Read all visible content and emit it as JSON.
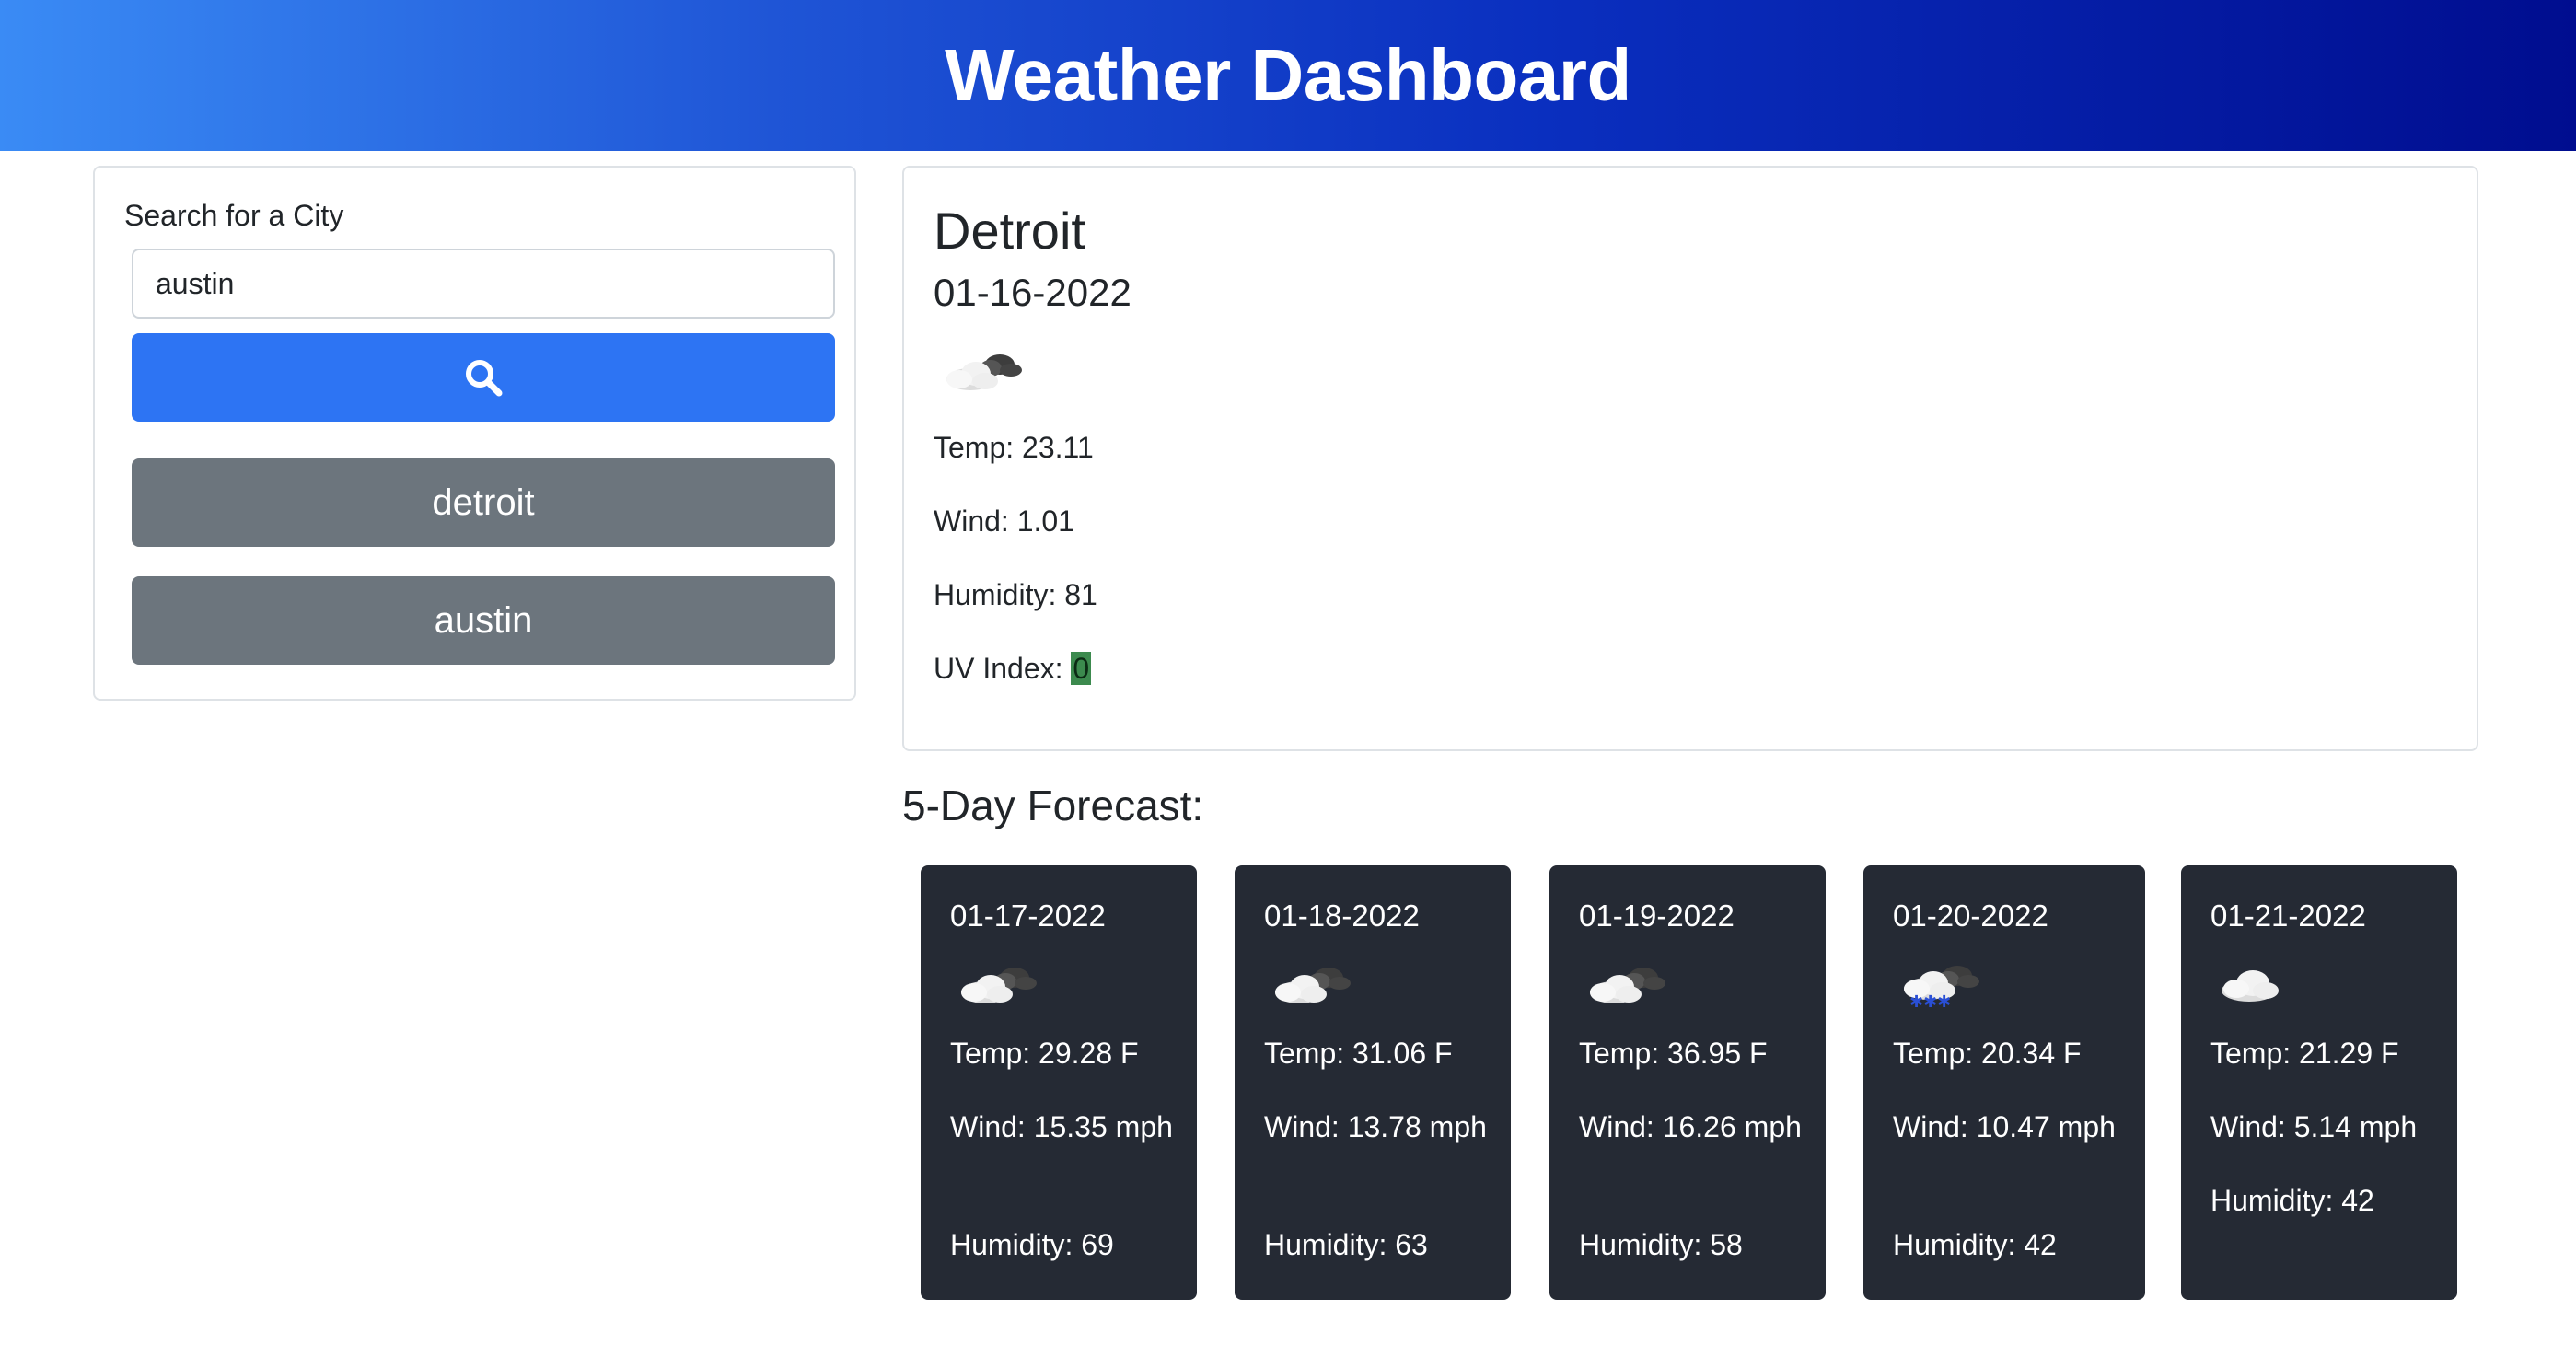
{
  "header": {
    "title": "Weather Dashboard"
  },
  "search": {
    "label": "Search for a City",
    "value": "austin",
    "button_icon": "search-icon",
    "history": [
      "detroit",
      "austin"
    ],
    "colors": {
      "search_button": "#2d74f3",
      "history_button": "#6c757d"
    }
  },
  "current": {
    "city": "Detroit",
    "date": "01-16-2022",
    "icon": "partly-cloudy-icon",
    "temp": "Temp: 23.11",
    "wind": "Wind: 1.01",
    "humidity": "Humidity: 81",
    "uv_label": "UV Index: ",
    "uv_value": "0",
    "uv_color": "#3c8a4e"
  },
  "forecast": {
    "title": "5-Day Forecast:",
    "days": [
      {
        "date": "01-17-2022",
        "icon": "partly-cloudy-icon",
        "temp": "Temp: 29.28 F",
        "wind": "Wind: 15.35 mph",
        "humidity": "Humidity: 69"
      },
      {
        "date": "01-18-2022",
        "icon": "partly-cloudy-icon",
        "temp": "Temp: 31.06 F",
        "wind": "Wind: 13.78 mph",
        "humidity": "Humidity: 63"
      },
      {
        "date": "01-19-2022",
        "icon": "partly-cloudy-icon",
        "temp": "Temp: 36.95 F",
        "wind": "Wind: 16.26 mph",
        "humidity": "Humidity: 58"
      },
      {
        "date": "01-20-2022",
        "icon": "snow-cloud-icon",
        "temp": "Temp: 20.34 F",
        "wind": "Wind: 10.47 mph",
        "humidity": "Humidity: 42"
      },
      {
        "date": "01-21-2022",
        "icon": "cloud-icon",
        "temp": "Temp: 21.29 F",
        "wind": "Wind: 5.14 mph",
        "humidity": "Humidity: 42"
      }
    ]
  }
}
